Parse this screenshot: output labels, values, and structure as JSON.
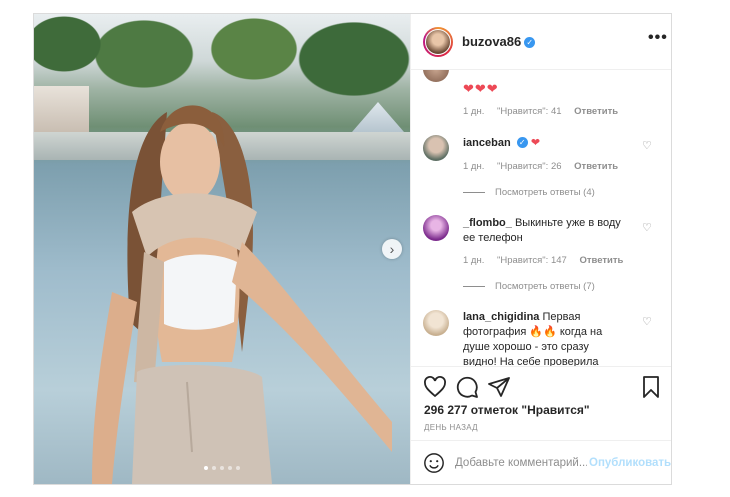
{
  "post": {
    "username": "buzova86",
    "more_label": "•••",
    "photo": {
      "current_slide": 1,
      "slide_count": 5,
      "next_arrow": "›"
    }
  },
  "comments": [
    {
      "text": "❤❤❤",
      "meta": {
        "age": "1 дн.",
        "likes": "\"Нравится\": 41",
        "reply": "Ответить"
      }
    },
    {
      "username": "ianceban",
      "text": "❤",
      "meta": {
        "age": "1 дн.",
        "likes": "\"Нравится\": 26",
        "reply": "Ответить"
      },
      "view_replies": "Посмотреть ответы (4)"
    },
    {
      "username": "_flombo_",
      "text": "Выкиньте уже в воду ее телефон",
      "meta": {
        "age": "1 дн.",
        "likes": "\"Нравится\": 147",
        "reply": "Ответить"
      },
      "view_replies": "Посмотреть ответы (7)"
    },
    {
      "username": "lana_chigidina",
      "text": "Первая фотография 🔥🔥 когда на душе хорошо - это сразу видно! На себе проверила миллион раз"
    }
  ],
  "likes_count": "296 277 отметок \"Нравится\"",
  "posted_ago": "ДЕНЬ НАЗАД",
  "add_comment": {
    "placeholder": "Добавьте комментарий...",
    "publish_label": "Опубликовать"
  },
  "icons": {
    "like": "heart-icon",
    "comment": "comment-icon",
    "share": "share-icon",
    "save": "bookmark-icon",
    "emoji": "emoji-icon",
    "verified": "verified-badge-icon"
  },
  "colors": {
    "verified": "#3897f0",
    "heart": "#ed4956",
    "publish_disabled": "#b2dffc"
  }
}
